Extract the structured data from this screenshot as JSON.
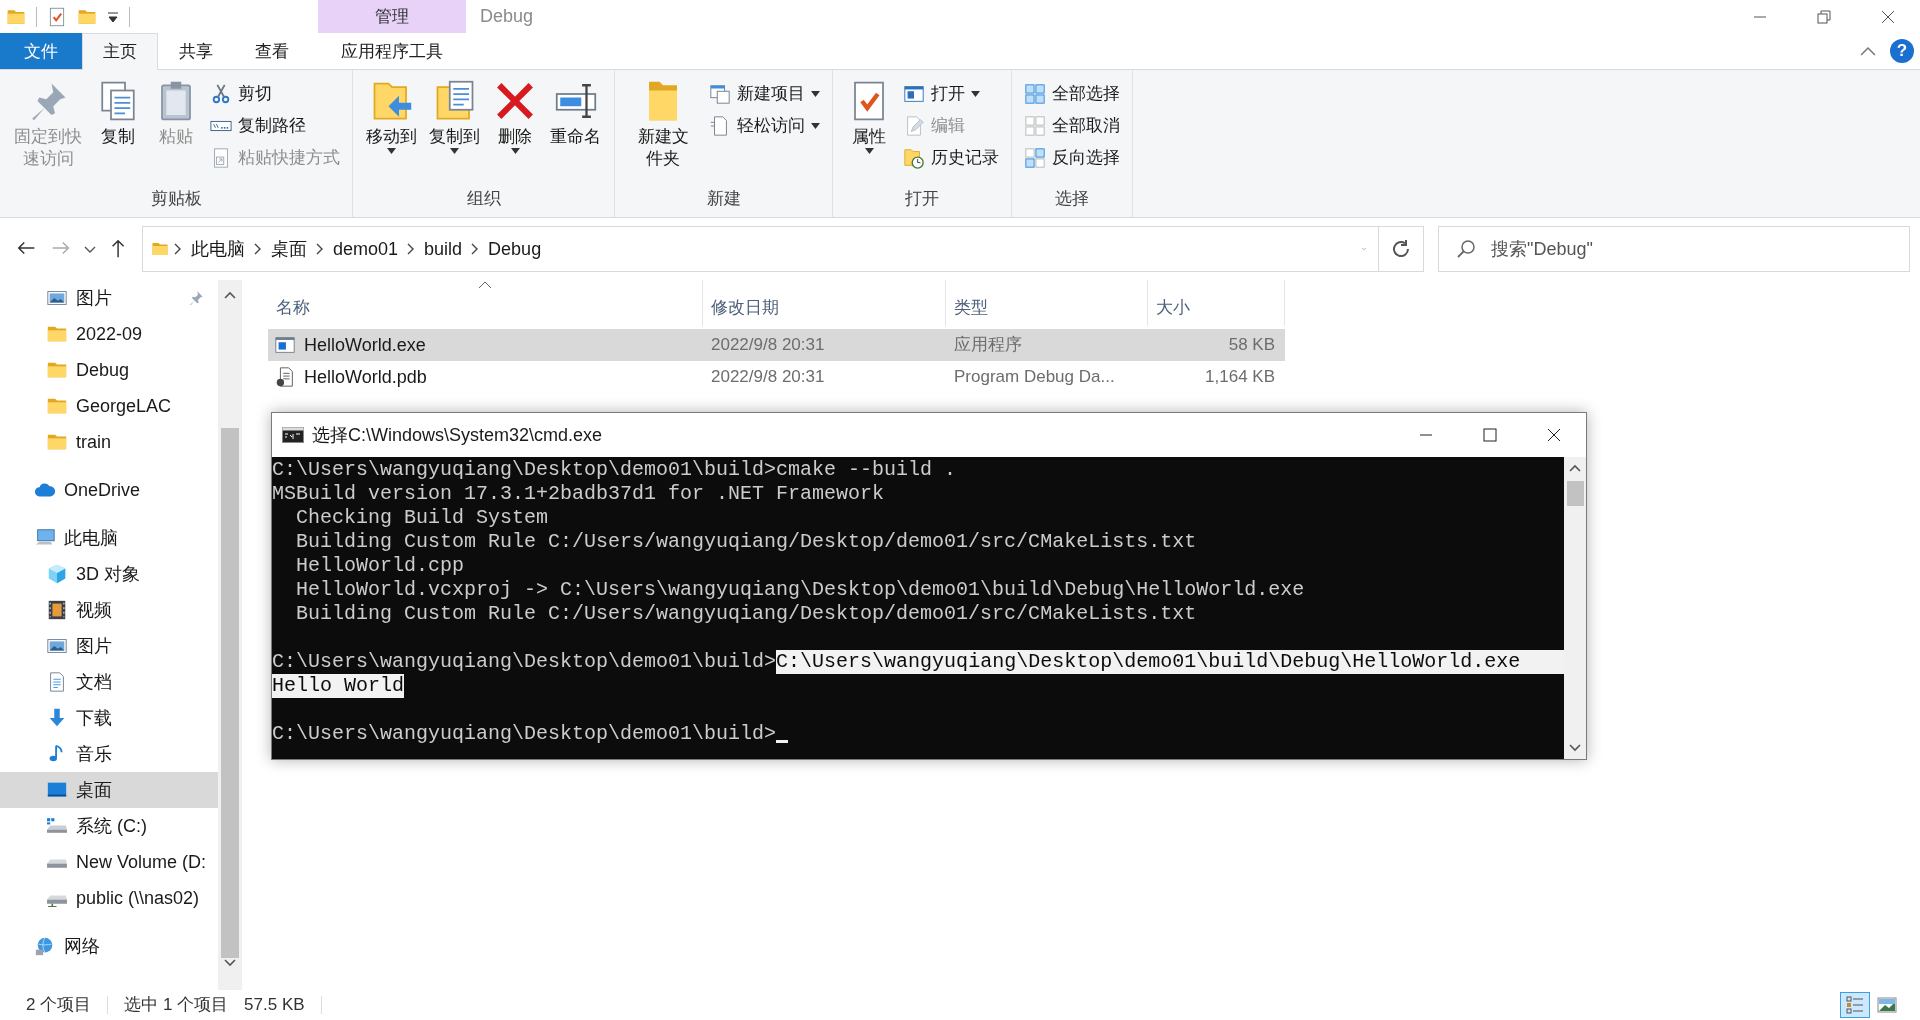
{
  "title_bar": {
    "context_tab": "管理",
    "title": "Debug"
  },
  "ribbon_tabs": [
    {
      "label": "文件",
      "kind": "file",
      "selected": false
    },
    {
      "label": "主页",
      "kind": "normal",
      "selected": true
    },
    {
      "label": "共享",
      "kind": "normal",
      "selected": false
    },
    {
      "label": "查看",
      "kind": "normal",
      "selected": false
    },
    {
      "label": "应用程序工具",
      "kind": "context",
      "selected": false
    }
  ],
  "help_button": "?",
  "ribbon_groups": [
    {
      "label": "剪贴板",
      "commands": [
        {
          "kind": "large",
          "label": "固定到快速访问",
          "disabled": true,
          "dropdown": false
        },
        {
          "kind": "large",
          "label": "复制",
          "disabled": false,
          "dropdown": false
        },
        {
          "kind": "large",
          "label": "粘贴",
          "disabled": true,
          "dropdown": false
        },
        {
          "kind": "small",
          "label": "剪切",
          "disabled": false,
          "dropdown": false
        },
        {
          "kind": "small",
          "label": "复制路径",
          "disabled": false,
          "dropdown": false
        },
        {
          "kind": "small",
          "label": "粘贴快捷方式",
          "disabled": true,
          "dropdown": false
        }
      ]
    },
    {
      "label": "组织",
      "commands": [
        {
          "kind": "large",
          "label": "移动到",
          "disabled": false,
          "dropdown": true
        },
        {
          "kind": "large",
          "label": "复制到",
          "disabled": false,
          "dropdown": true
        },
        {
          "kind": "large",
          "label": "删除",
          "disabled": false,
          "dropdown": true
        },
        {
          "kind": "large",
          "label": "重命名",
          "disabled": false,
          "dropdown": false
        }
      ]
    },
    {
      "label": "新建",
      "commands": [
        {
          "kind": "large",
          "label": "新建文件夹",
          "disabled": false,
          "dropdown": false
        },
        {
          "kind": "small",
          "label": "新建项目",
          "disabled": false,
          "dropdown": true
        },
        {
          "kind": "small",
          "label": "轻松访问",
          "disabled": false,
          "dropdown": true
        }
      ]
    },
    {
      "label": "打开",
      "commands": [
        {
          "kind": "large",
          "label": "属性",
          "disabled": false,
          "dropdown": true
        },
        {
          "kind": "small",
          "label": "打开",
          "disabled": false,
          "dropdown": true
        },
        {
          "kind": "small",
          "label": "编辑",
          "disabled": true,
          "dropdown": false
        },
        {
          "kind": "small",
          "label": "历史记录",
          "disabled": false,
          "dropdown": false
        }
      ]
    },
    {
      "label": "选择",
      "commands": [
        {
          "kind": "small",
          "label": "全部选择",
          "disabled": false,
          "dropdown": false
        },
        {
          "kind": "small",
          "label": "全部取消",
          "disabled": false,
          "dropdown": false
        },
        {
          "kind": "small",
          "label": "反向选择",
          "disabled": false,
          "dropdown": false
        }
      ]
    }
  ],
  "address_bar": {
    "crumbs": [
      "此电脑",
      "桌面",
      "demo01",
      "build",
      "Debug"
    ]
  },
  "search": {
    "placeholder": "搜索\"Debug\""
  },
  "nav_pane": {
    "quick_access": [
      {
        "label": "图片",
        "pinned": true,
        "selected": false
      },
      {
        "label": "2022-09",
        "pinned": false,
        "selected": false
      },
      {
        "label": "Debug",
        "pinned": false,
        "selected": false
      },
      {
        "label": "GeorgeLAC",
        "pinned": false,
        "selected": false
      },
      {
        "label": "train",
        "pinned": false,
        "selected": false
      }
    ],
    "items": [
      {
        "label": "OneDrive",
        "selected": false
      },
      {
        "label": "此电脑",
        "selected": false,
        "children": [
          {
            "label": "3D 对象",
            "selected": false
          },
          {
            "label": "视频",
            "selected": false
          },
          {
            "label": "图片",
            "selected": false
          },
          {
            "label": "文档",
            "selected": false
          },
          {
            "label": "下载",
            "selected": false
          },
          {
            "label": "音乐",
            "selected": false
          },
          {
            "label": "桌面",
            "selected": true
          },
          {
            "label": "系统 (C:)",
            "selected": false
          },
          {
            "label": "New Volume (D:",
            "selected": false
          },
          {
            "label": "public (\\\\nas02)",
            "selected": false
          }
        ]
      },
      {
        "label": "网络",
        "selected": false
      }
    ]
  },
  "file_list": {
    "columns": [
      {
        "label": "名称",
        "sorted": true
      },
      {
        "label": "修改日期",
        "sorted": false
      },
      {
        "label": "类型",
        "sorted": false
      },
      {
        "label": "大小",
        "sorted": false
      }
    ],
    "rows": [
      {
        "name": "HelloWorld.exe",
        "date": "2022/9/8 20:31",
        "type": "应用程序",
        "size": "58 KB",
        "selected": true
      },
      {
        "name": "HelloWorld.pdb",
        "date": "2022/9/8 20:31",
        "type": "Program Debug Da...",
        "size": "1,164 KB",
        "selected": false
      }
    ]
  },
  "console": {
    "title": "选择C:\\Windows\\System32\\cmd.exe",
    "lines": [
      {
        "kind": "text",
        "cursor": false,
        "segments": [
          {
            "text": "C:\\Users\\wangyuqiang\\Desktop\\demo01\\build>cmake --build .",
            "selected": false
          }
        ]
      },
      {
        "kind": "text",
        "cursor": false,
        "segments": [
          {
            "text": "MSBuild version 17.3.1+2badb37d1 for .NET Framework",
            "selected": false
          }
        ]
      },
      {
        "kind": "text",
        "cursor": false,
        "segments": [
          {
            "text": "  Checking Build System",
            "selected": false
          }
        ]
      },
      {
        "kind": "text",
        "cursor": false,
        "segments": [
          {
            "text": "  Building Custom Rule C:/Users/wangyuqiang/Desktop/demo01/src/CMakeLists.txt",
            "selected": false
          }
        ]
      },
      {
        "kind": "text",
        "cursor": false,
        "segments": [
          {
            "text": "  HelloWorld.cpp",
            "selected": false
          }
        ]
      },
      {
        "kind": "text",
        "cursor": false,
        "segments": [
          {
            "text": "  HelloWorld.vcxproj -> C:\\Users\\wangyuqiang\\Desktop\\demo01\\build\\Debug\\HelloWorld.exe",
            "selected": false
          }
        ]
      },
      {
        "kind": "text",
        "cursor": false,
        "segments": [
          {
            "text": "  Building Custom Rule C:/Users/wangyuqiang/Desktop/demo01/src/CMakeLists.txt",
            "selected": false
          }
        ]
      },
      {
        "kind": "blank"
      },
      {
        "kind": "text",
        "cursor": false,
        "segments": [
          {
            "text": "C:\\Users\\wangyuqiang\\Desktop\\demo01\\build>",
            "selected": false
          },
          {
            "text": "C:\\Users\\wangyuqiang\\Desktop\\demo01\\build\\Debug\\HelloWorld.exe",
            "selected": true
          }
        ]
      },
      {
        "kind": "text",
        "cursor": false,
        "segments": [
          {
            "text": "Hello World",
            "selected": true
          }
        ]
      },
      {
        "kind": "blank"
      },
      {
        "kind": "text",
        "cursor": true,
        "segments": [
          {
            "text": "C:\\Users\\wangyuqiang\\Desktop\\demo01\\build>",
            "selected": false
          }
        ]
      }
    ]
  },
  "status_bar": {
    "item_count": "2 个项目",
    "selection": "选中 1 个项目",
    "selection_size": "57.5 KB",
    "views": [
      {
        "kind": "details",
        "selected": true
      },
      {
        "kind": "large_icons",
        "selected": false
      }
    ]
  }
}
